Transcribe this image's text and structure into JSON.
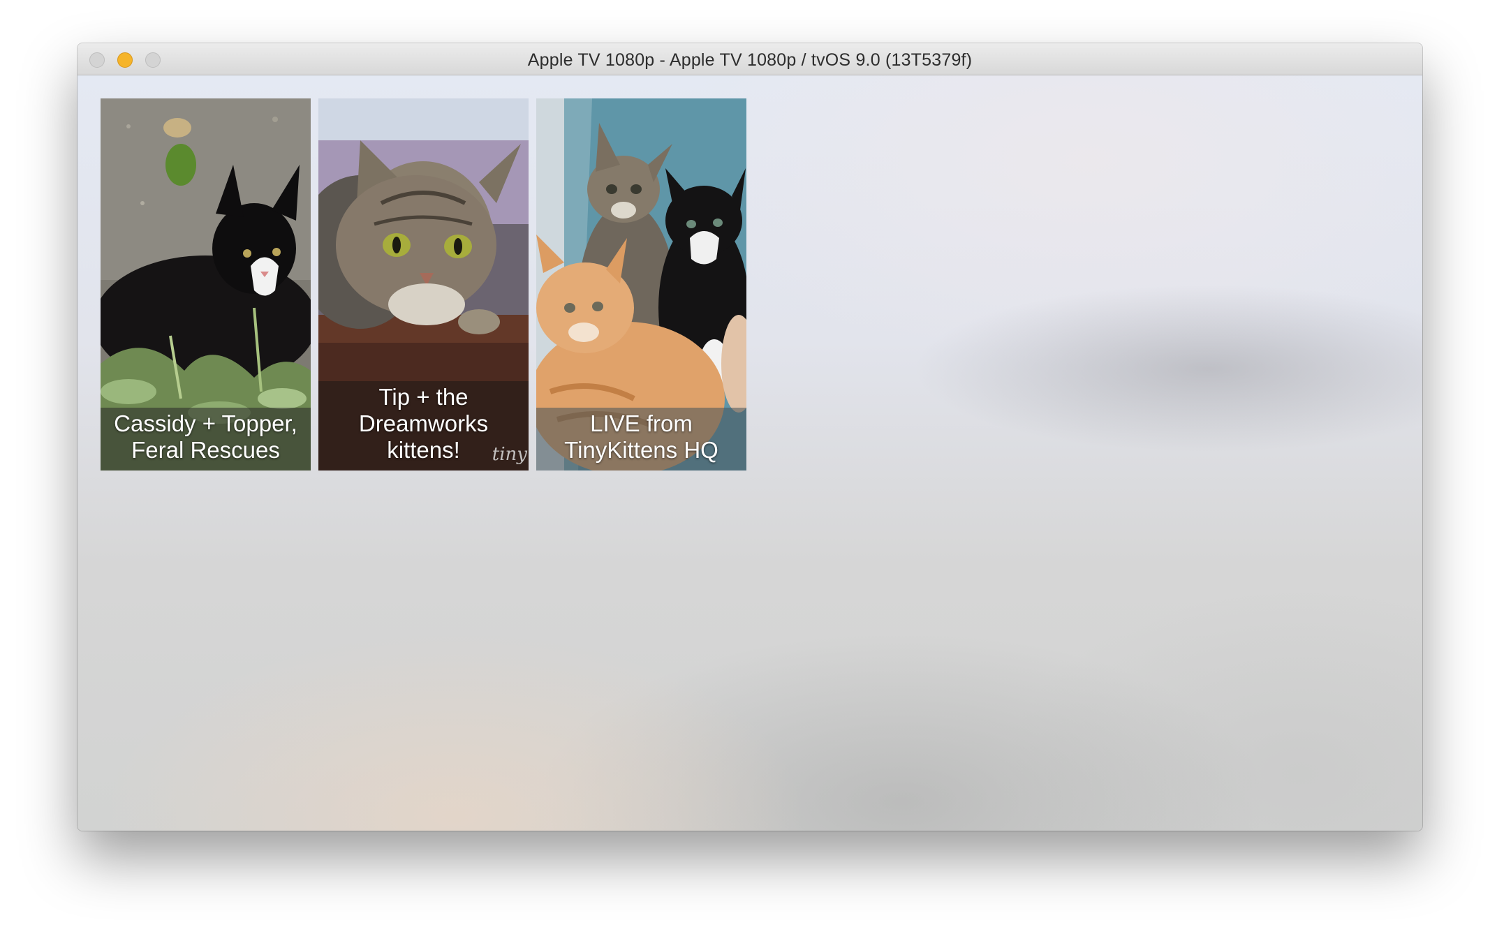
{
  "window": {
    "title": "Apple TV 1080p - Apple TV 1080p / tvOS 9.0 (13T5379f)"
  },
  "tiles": [
    {
      "caption_lines": [
        "Cassidy + Topper,",
        "Feral Rescues"
      ],
      "image": "kitten-black-white-in-grass-photo"
    },
    {
      "caption_lines": [
        "Tip + the",
        "Dreamworks",
        "kittens!"
      ],
      "image": "tabby-cat-on-wood-photo",
      "watermark": "tiny"
    },
    {
      "caption_lines": [
        "LIVE from",
        "TinyKittens HQ"
      ],
      "image": "three-kittens-orange-tabby-tuxedo-photo"
    }
  ]
}
